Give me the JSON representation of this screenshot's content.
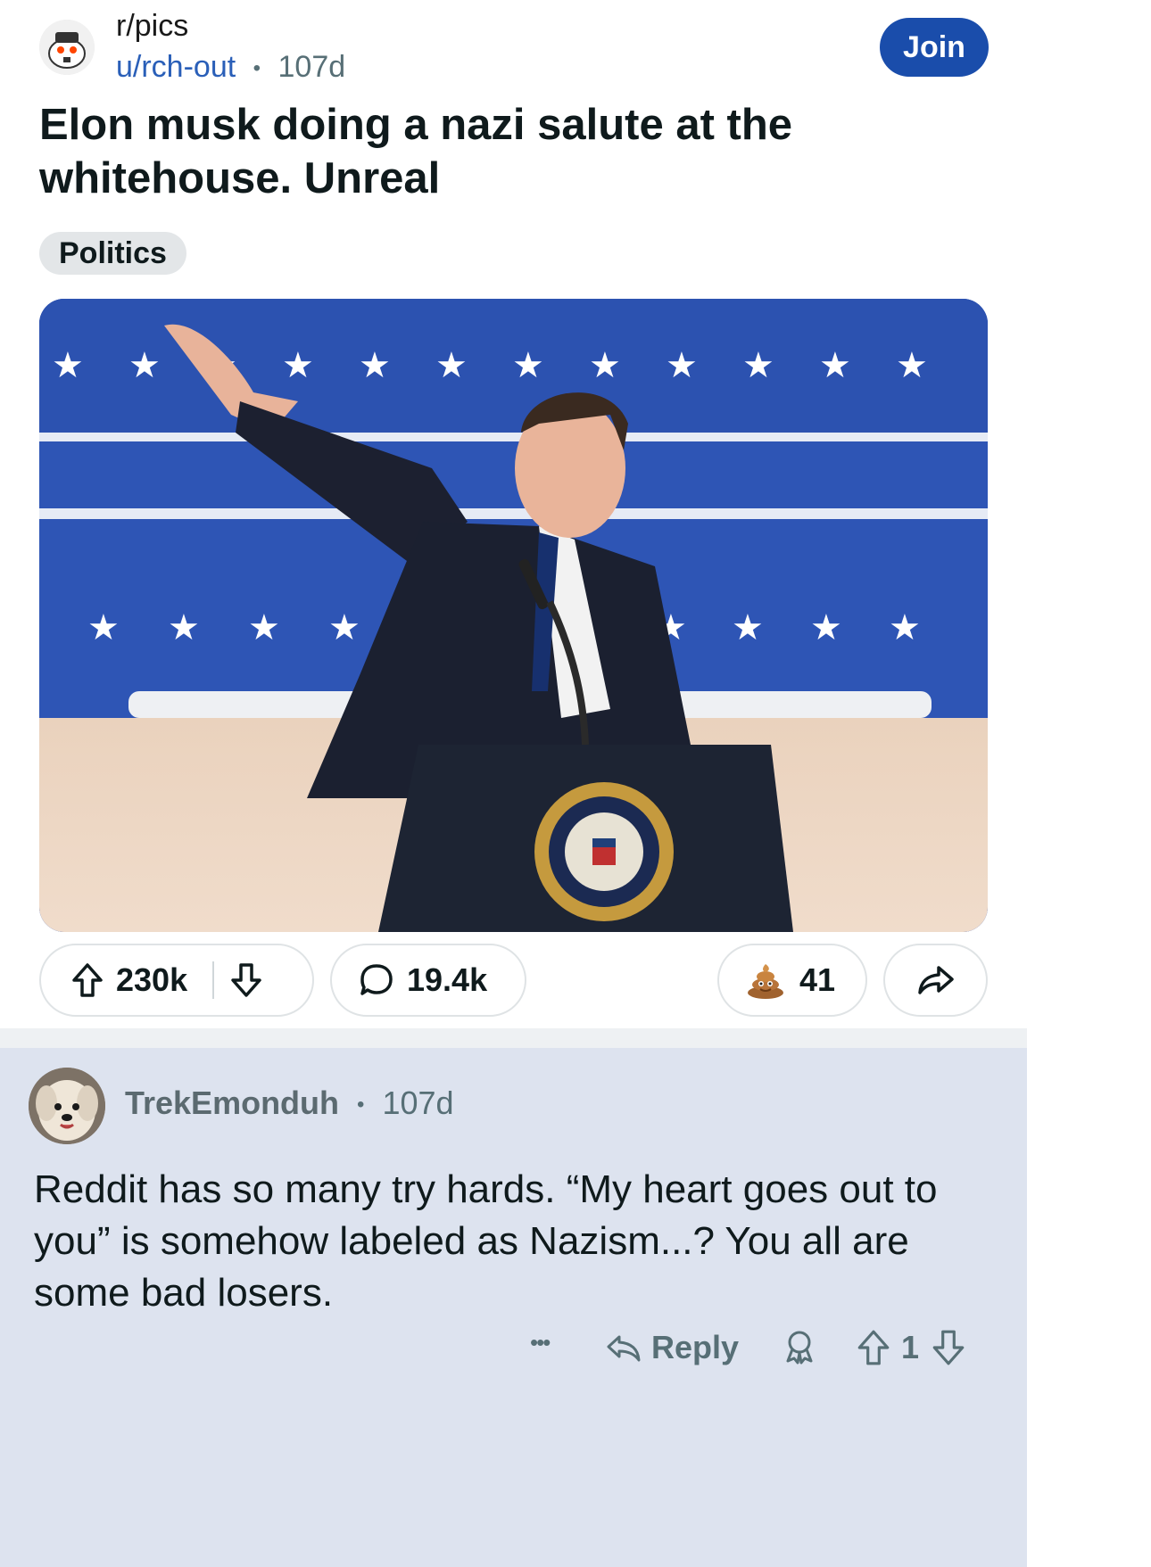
{
  "header": {
    "subreddit": "r/pics",
    "author": "u/rch-out",
    "separator": "•",
    "age": "107d",
    "join_label": "Join"
  },
  "post": {
    "title": "Elon musk doing a nazi salute at the whitehouse. Unreal",
    "flair": "Politics",
    "image_alt": "Photo of a man in a dark suit raising his right arm behind a presidential podium in front of a blue starred backdrop"
  },
  "actions": {
    "upvotes": "230k",
    "comments": "19.4k",
    "awards": "41",
    "icons": [
      "arrow-up-icon",
      "arrow-down-icon",
      "comment-bubble-icon",
      "award-poop-icon",
      "share-arrow-icon"
    ]
  },
  "comment": {
    "username": "TrekEmonduh",
    "separator": "•",
    "age": "107d",
    "body": "Reddit has so many try hards. “My heart goes out to you” is somehow labeled as Nazism...? You all are some bad losers.",
    "more_label": "•••",
    "reply_label": "Reply",
    "score": "1"
  },
  "colors": {
    "join_button": "#1a4dab",
    "author_link": "#2a5fb8",
    "comment_background": "#dde3ef",
    "podium": "#1d2433",
    "backdrop_blue": "#2c4fb0"
  }
}
